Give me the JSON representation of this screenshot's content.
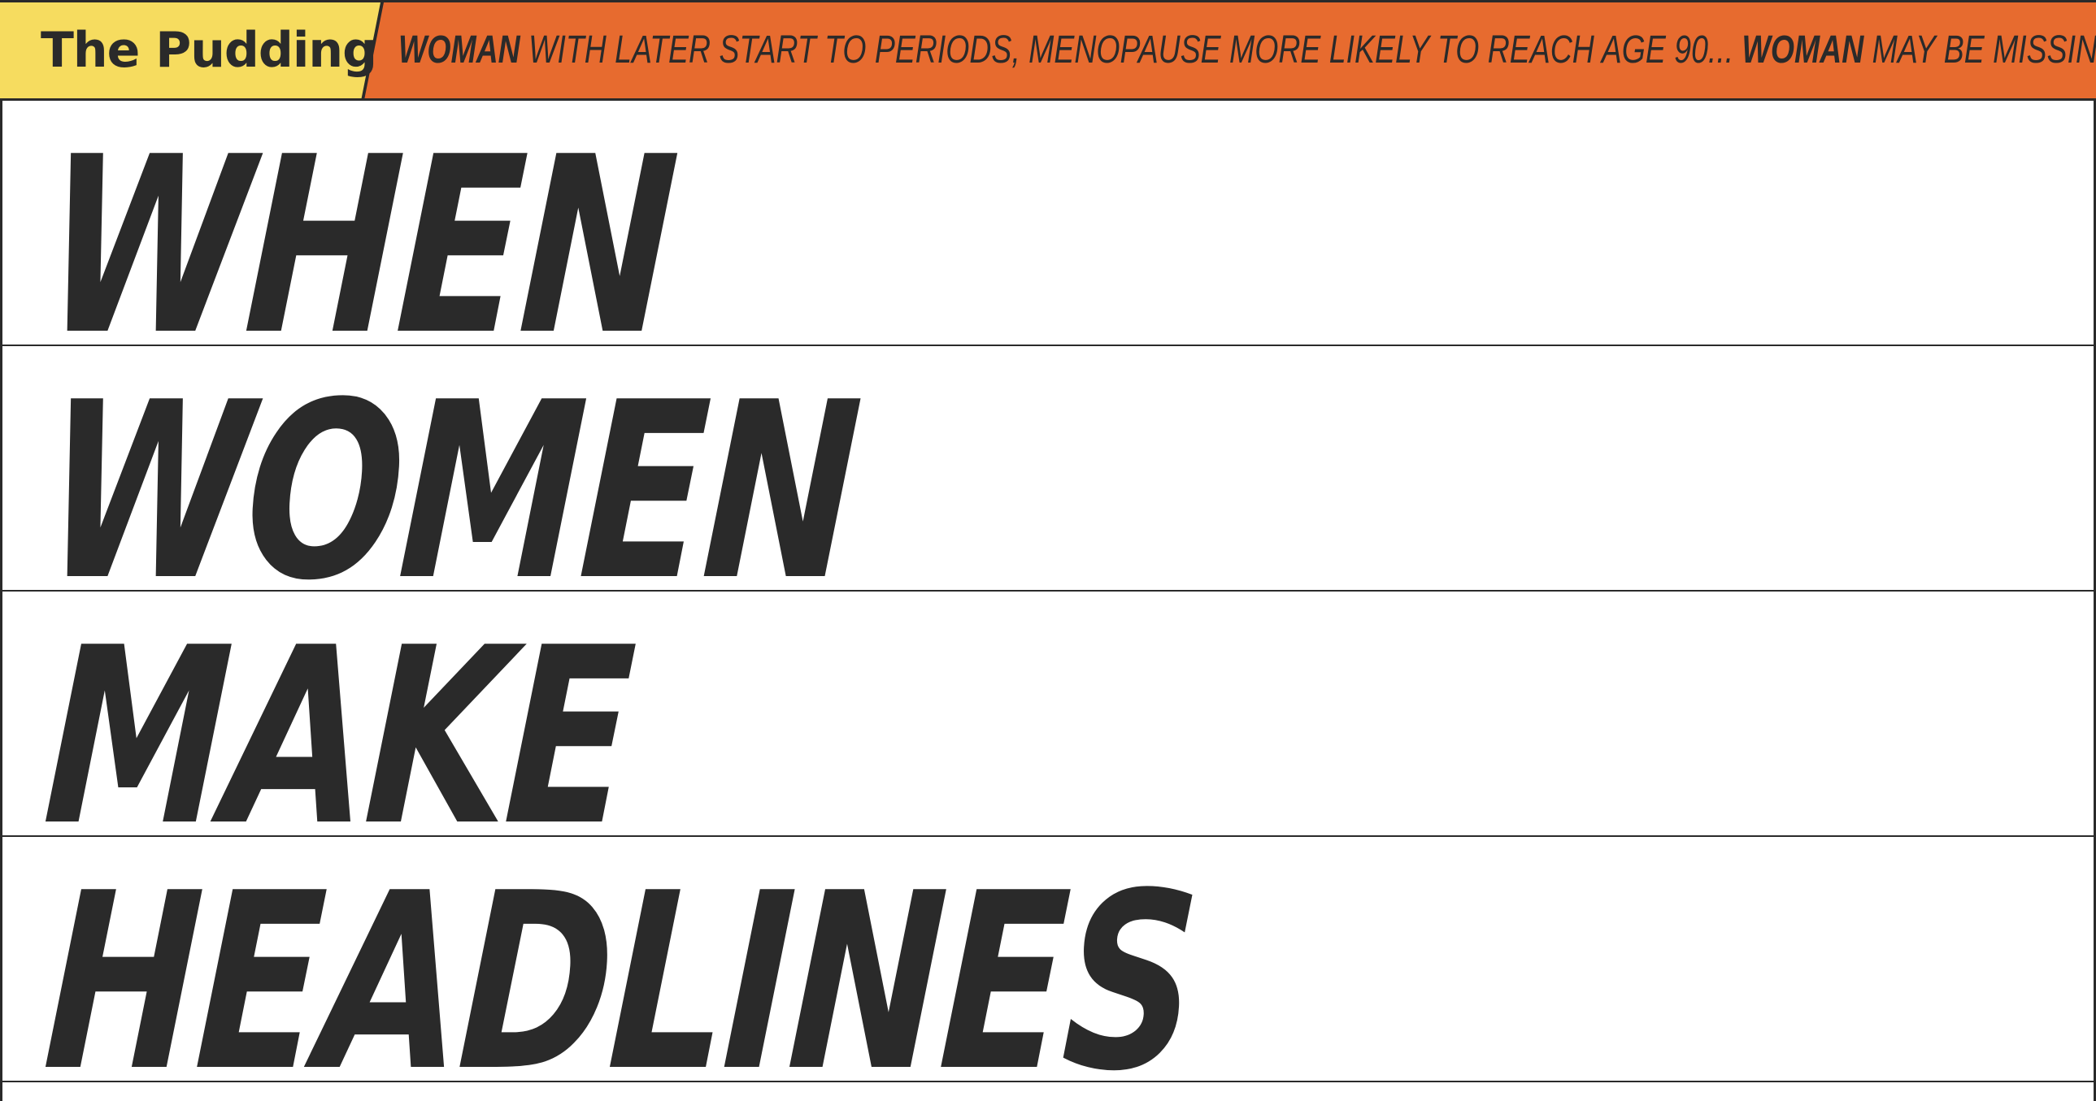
{
  "header": {
    "logo_text": "The Pudding",
    "ticker": [
      {
        "subject": "WOMAN",
        "text": " WITH LATER START TO PERIODS, MENOPAUSE MORE LIKELY TO REACH AGE 90... "
      },
      {
        "subject": "WOMAN",
        "text": " MAY BE MISSING O"
      }
    ]
  },
  "hero": {
    "lines": [
      "WHEN",
      "WOMEN",
      "MAKE",
      "HEADLINES"
    ]
  },
  "colors": {
    "topbar_bg": "#e76b2f",
    "logo_bg": "#f6dc5f",
    "text": "#2a2a2a",
    "page_bg": "#ffffff"
  }
}
